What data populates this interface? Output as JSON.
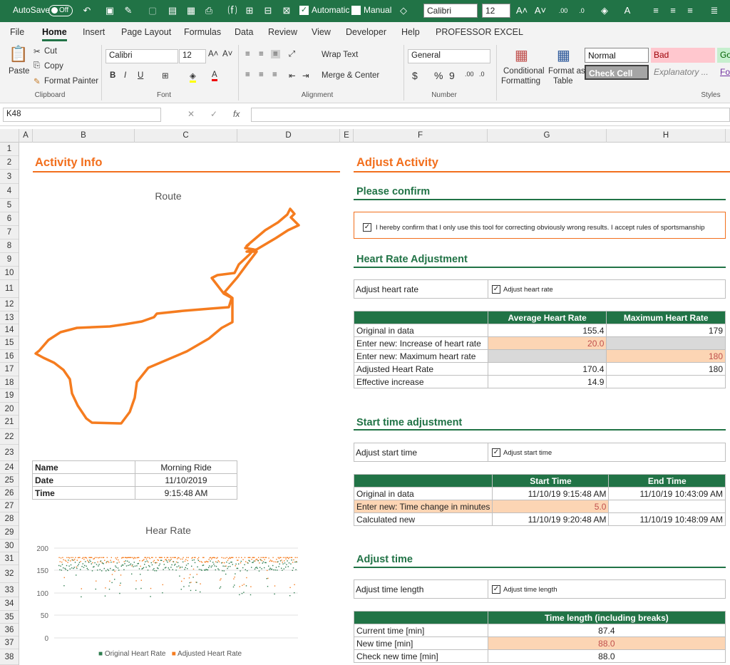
{
  "qat": {
    "autosave_label": "AutoSave",
    "autosave_state": "Off",
    "calc_automatic": "Automatic",
    "calc_manual": "Manual",
    "font_name": "Calibri",
    "font_size": "12"
  },
  "tabs": [
    "File",
    "Home",
    "Insert",
    "Page Layout",
    "Formulas",
    "Data",
    "Review",
    "View",
    "Developer",
    "Help",
    "PROFESSOR EXCEL"
  ],
  "ribbon": {
    "paste": "Paste",
    "cut": "Cut",
    "copy": "Copy",
    "format_painter": "Format Painter",
    "clipboard": "Clipboard",
    "font_name": "Calibri",
    "font_size": "12",
    "font_group": "Font",
    "wrap_text": "Wrap Text",
    "merge_center": "Merge & Center",
    "alignment": "Alignment",
    "number_format": "General",
    "number": "Number",
    "conditional": "Conditional",
    "formatting": "Formatting",
    "format_as": "Format as",
    "table": "Table",
    "styles": "Styles",
    "style_normal": "Normal",
    "style_bad": "Bad",
    "style_good": "Go",
    "style_check": "Check Cell",
    "style_explanatory": "Explanatory ...",
    "style_fo": "Fo"
  },
  "formula_bar": {
    "name_box": "K48",
    "fx": "fx",
    "content": ""
  },
  "columns": [
    "A",
    "B",
    "C",
    "D",
    "E",
    "F",
    "G",
    "H"
  ],
  "rows": [
    "1",
    "2",
    "3",
    "4",
    "5",
    "6",
    "7",
    "8",
    "9",
    "10",
    "11",
    "12",
    "13",
    "14",
    "15",
    "16",
    "17",
    "18",
    "19",
    "20",
    "21",
    "22",
    "23",
    "24",
    "25",
    "26",
    "27",
    "28",
    "29",
    "30",
    "31",
    "32",
    "33",
    "34",
    "35",
    "36",
    "37",
    "38"
  ],
  "activity_info": {
    "title": "Activity Info",
    "route_title": "Route",
    "name_label": "Name",
    "name_value": "Morning Ride",
    "date_label": "Date",
    "date_value": "11/10/2019",
    "time_label": "Time",
    "time_value": "9:15:48 AM",
    "hr_title": "Hear Rate",
    "hr_legend_original": "Original Heart Rate",
    "hr_legend_adjusted": "Adjusted Heart Rate",
    "hr_ticks": [
      "200",
      "150",
      "100",
      "50",
      "0"
    ]
  },
  "adjust": {
    "title": "Adjust Activity",
    "confirm_heading": "Please confirm",
    "confirm_text": "I hereby confirm that I only use this tool for correcting obviously wrong results. I accept rules of sportsmanship",
    "hr_heading": "Heart Rate Adjustment",
    "hr_adjust_label": "Adjust heart rate",
    "hr_adjust_check": "Adjust heart rate",
    "hr_table": {
      "headers": [
        "",
        "Average Heart Rate",
        "Maximum Heart Rate"
      ],
      "rows": [
        [
          "Original in data",
          "155.4",
          "179"
        ],
        [
          "Enter new: Increase of heart rate",
          "20.0",
          ""
        ],
        [
          "Enter new: Maximum heart rate",
          "",
          "180"
        ],
        [
          "Adjusted Heart Rate",
          "170.4",
          "180"
        ],
        [
          "Effective increase",
          "14.9",
          ""
        ]
      ]
    },
    "start_heading": "Start time adjustment",
    "start_adjust_label": "Adjust start time",
    "start_adjust_check": "Adjust start time",
    "start_table": {
      "headers": [
        "",
        "Start Time",
        "End Time"
      ],
      "rows": [
        [
          "Original in data",
          "11/10/19 9:15:48 AM",
          "11/10/19 10:43:09 AM"
        ],
        [
          "Enter new: Time change in minutes",
          "5.0",
          ""
        ],
        [
          "Calculated new",
          "11/10/19 9:20:48 AM",
          "11/10/19 10:48:09 AM"
        ]
      ]
    },
    "time_heading": "Adjust time",
    "time_adjust_label": "Adjust time length",
    "time_adjust_check": "Adjust time length",
    "time_table": {
      "header": "Time length (including breaks)",
      "rows": [
        [
          "Current time [min]",
          "87.4"
        ],
        [
          "New time [min]",
          "88.0"
        ],
        [
          "Check new time [min]",
          "88.0"
        ]
      ]
    }
  },
  "colors": {
    "excel_green": "#217346",
    "accent_orange": "#f26f1d",
    "input_fill": "#fcd5b4",
    "original_series": "#2e7d4f",
    "adjusted_series": "#f57c1f"
  }
}
